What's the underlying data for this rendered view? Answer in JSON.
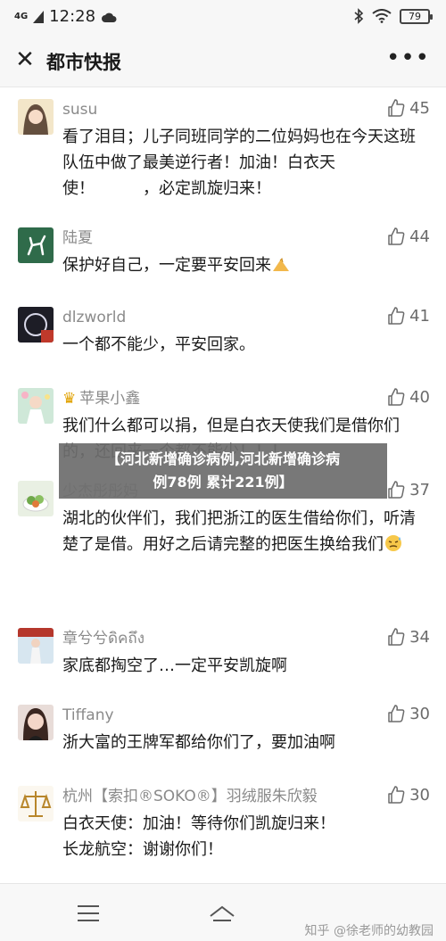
{
  "status_bar": {
    "network": "4G",
    "time": "12:28",
    "battery": "79"
  },
  "header": {
    "title": "都市快报"
  },
  "banner": {
    "line1": "【河北新增确诊病例,河北新增确诊病",
    "line2": "例78例 累计221例】"
  },
  "comments": [
    {
      "user": "susu",
      "likes": "45",
      "text": "看了泪目；儿子同班同学的二位妈妈也在今天这班队伍中做了最美逆行者！加油！白衣天使！　　　，必定凯旋归来！"
    },
    {
      "user": "陆夏",
      "likes": "44",
      "text": "保护好自己，一定要平安回来"
    },
    {
      "user": "dlzworld",
      "likes": "41",
      "text": "一个都不能少，平安回家。"
    },
    {
      "user": "苹果小鑫",
      "likes": "40",
      "text": "我们什么都可以捐，但是白衣天使我们是借你们的，还回来一个都不能少！！！"
    },
    {
      "user": "少杰彤彤妈",
      "likes": "37",
      "text": "湖北的伙伴们，我们把浙江的医生借给你们，听清楚了是借。用好之后请完整的把医生换给我们"
    },
    {
      "user": "章兮兮ดิคถึง",
      "likes": "34",
      "text": "家底都掏空了…一定平安凯旋啊"
    },
    {
      "user": "Tiffany",
      "likes": "30",
      "text": "浙大富的王牌军都给你们了，要加油啊"
    },
    {
      "user": "杭州【索扣®SOKO®】羽绒服朱欣毅",
      "likes": "30",
      "text": "白衣天使：加油！等待你们凯旋归来！\n长龙航空：谢谢你们！"
    },
    {
      "user": "",
      "likes": "",
      "text": ""
    }
  ],
  "watermark": "知乎 @徐老师的幼教园",
  "colors": {
    "accent_crown": "#e0a100",
    "banner_bg": "#6e6e6e",
    "muted_text": "#8a8a8a"
  }
}
